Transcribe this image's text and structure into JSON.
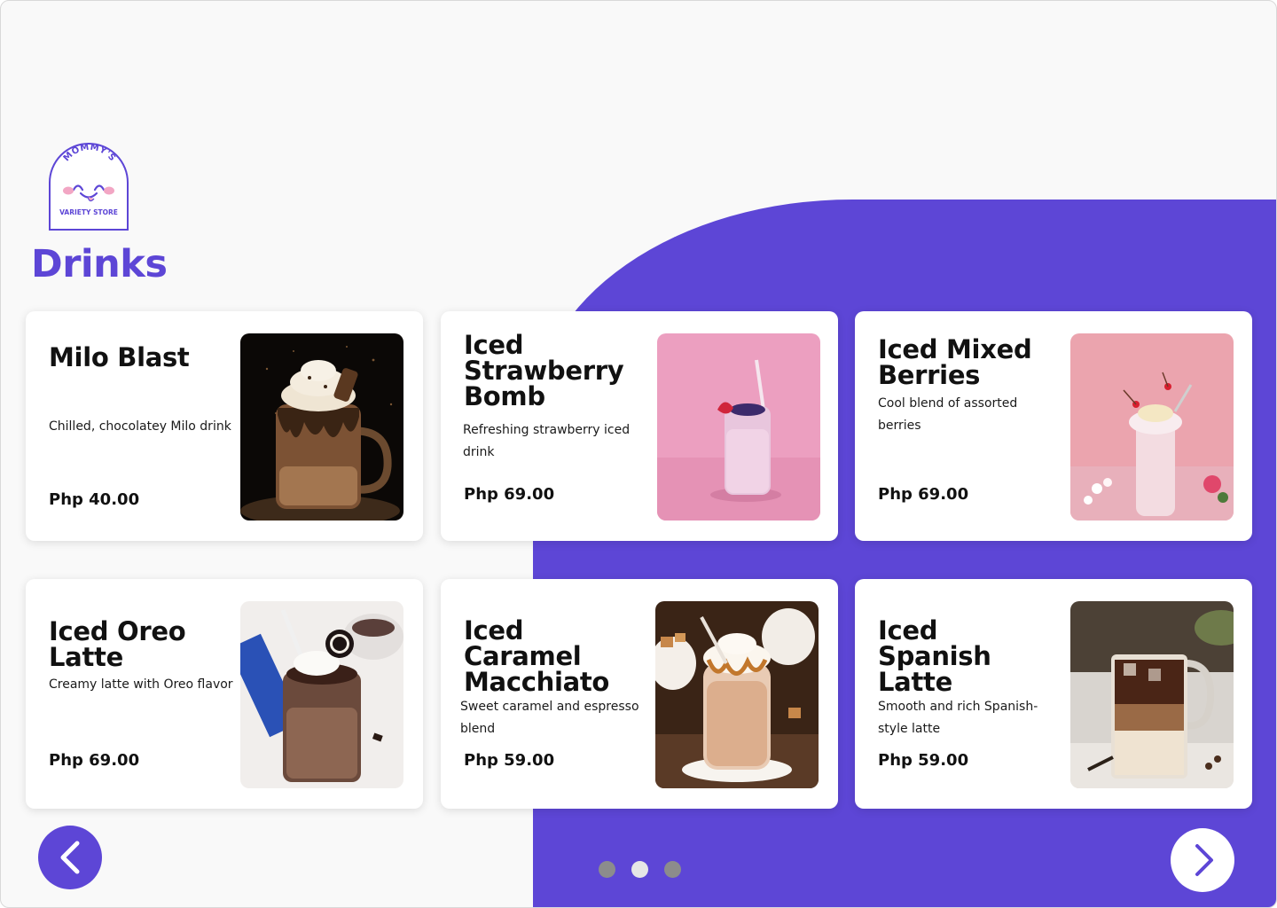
{
  "app": {
    "logo_top": "MOMMY'S",
    "logo_bottom": "VARIETY STORE",
    "page_title": "Drinks",
    "brand_color": "#5d46d6"
  },
  "products": [
    {
      "name": "Milo Blast",
      "description": "Chilled, chocolatey Milo drink",
      "price": "Php 40.00",
      "image": "milo-blast-image"
    },
    {
      "name": "Iced Strawberry Bomb",
      "description": "Refreshing strawberry iced drink",
      "price": "Php 69.00",
      "image": "iced-strawberry-bomb-image"
    },
    {
      "name": "Iced Mixed Berries",
      "description": "Cool blend of assorted berries",
      "price": "Php 69.00",
      "image": "iced-mixed-berries-image"
    },
    {
      "name": "Iced Oreo Latte",
      "description": "Creamy latte with Oreo flavor",
      "price": "Php 69.00",
      "image": "iced-oreo-latte-image"
    },
    {
      "name": "Iced Caramel Macchiato",
      "description": "Sweet caramel and espresso blend",
      "price": "Php 59.00",
      "image": "iced-caramel-macchiato-image"
    },
    {
      "name": "Iced Spanish Latte",
      "description": "Smooth and rich Spanish-style latte",
      "price": "Php 59.00",
      "image": "iced-spanish-latte-image"
    }
  ],
  "navigation": {
    "prev_icon": "chevron-left-icon",
    "next_icon": "chevron-right-icon"
  },
  "pagination": {
    "pages": 3,
    "active_page": 2,
    "active_color": "#e6e6e6",
    "inactive_color": "#8c8c8c"
  }
}
